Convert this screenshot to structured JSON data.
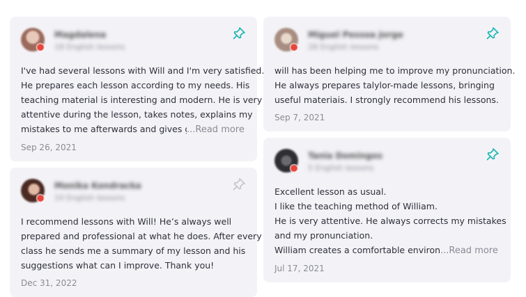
{
  "reviews": [
    {
      "name": "Magdalena",
      "lessons": "18 English lessons",
      "avatar_color": "#b08a80",
      "pinned": true,
      "text": [
        "I've had several lessons with Will and I'm very satisfied.",
        "He prepares each lesson according to my needs. His",
        "teaching material is interesting and modern. He is very",
        "attentive during the lesson, takes notes, explains my"
      ],
      "clipped_line": "mistakes to me afterwards and gives good",
      "more_label": "...Read more",
      "date": "Sep 26, 2021"
    },
    {
      "name": "Monika Kondracka",
      "lessons": "10 English lessons",
      "avatar_color": "#8a5a4c",
      "pinned": false,
      "text": [
        "I recommend lessons with Will! He’s always well",
        "prepared and professional at what he does. After every",
        "class he sends me a summary of my lesson and his",
        "suggestions what can I improve. Thank you!"
      ],
      "date": "Dec 31, 2022"
    },
    {
      "name": "Miguel Pessoa Jorge",
      "lessons": "28 English lessons",
      "avatar_color": "#c7b3a6",
      "pinned": true,
      "text": [
        "will has been helping me to improve my pronunciation.",
        "He always prepares talylor-made lessons, bringing",
        "useful materiais. I strongly recommend his lessons."
      ],
      "date": "Sep 7, 2021"
    },
    {
      "name": "Tania Domingos",
      "lessons": "5 English lessons",
      "avatar_color": "#3f3f44",
      "pinned": true,
      "text": [
        "Excellent lesson as usual.",
        "I like the teaching method of William.",
        "He is very attentive. He always corrects my mistakes",
        "and my pronunciation."
      ],
      "clipped_line": "William creates a comfortable environment",
      "more_label": "...Read more",
      "date": "Jul 17, 2021"
    }
  ],
  "colors": {
    "pin_active": "#1bb5b3",
    "pin_inactive": "#c4c4cc",
    "card_bg": "#f3f3f7"
  },
  "icons": {
    "pin": "pushpin-icon"
  }
}
